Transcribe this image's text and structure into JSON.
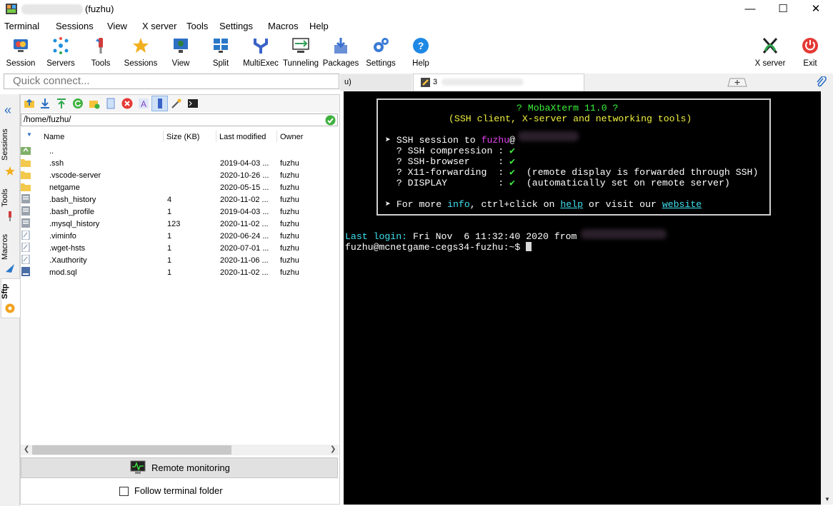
{
  "window": {
    "title": "(fuzhu)",
    "minimize": "—",
    "maximize": "☐",
    "close": "✕"
  },
  "menu": [
    "Terminal",
    "Sessions",
    "View",
    "X server",
    "Tools",
    "Settings",
    "Macros",
    "Help"
  ],
  "toolbar": [
    {
      "label": "Session",
      "icon": "session-icon",
      "color": "#3a7bd5"
    },
    {
      "label": "Servers",
      "icon": "servers-icon",
      "color": "#1f8fe0"
    },
    {
      "label": "Tools",
      "icon": "tools-icon",
      "color": "#d23b3b"
    },
    {
      "label": "Sessions",
      "icon": "star-icon",
      "color": "#f2b01e"
    },
    {
      "label": "View",
      "icon": "view-icon",
      "color": "#2f7f3f"
    },
    {
      "label": "Split",
      "icon": "split-icon",
      "color": "#2a78c8"
    },
    {
      "label": "MultiExec",
      "icon": "multiexec-icon",
      "color": "#3a62c8"
    },
    {
      "label": "Tunneling",
      "icon": "tunneling-icon",
      "color": "#2f9f5a"
    },
    {
      "label": "Packages",
      "icon": "packages-icon",
      "color": "#3a6fd0"
    },
    {
      "label": "Settings",
      "icon": "gear-icon",
      "color": "#3a7bd5"
    },
    {
      "label": "Help",
      "icon": "help-icon",
      "color": "#1e88e5"
    }
  ],
  "toolbar_right": [
    {
      "label": "X server",
      "icon": "x-server-icon"
    },
    {
      "label": "Exit",
      "icon": "power-icon"
    }
  ],
  "quick_connect": {
    "placeholder": "Quick connect..."
  },
  "side_tabs": [
    "Sessions",
    "Tools",
    "Macros",
    "Sftp"
  ],
  "sftp": {
    "path": "/home/fuzhu/",
    "columns": [
      "Name",
      "Size (KB)",
      "Last modified",
      "Owner"
    ],
    "rows": [
      {
        "name": "..",
        "size": "",
        "modified": "",
        "owner": "",
        "type": "up"
      },
      {
        "name": ".ssh",
        "size": "",
        "modified": "2019-04-03 ...",
        "owner": "fuzhu",
        "type": "folder"
      },
      {
        "name": ".vscode-server",
        "size": "",
        "modified": "2020-10-26 ...",
        "owner": "fuzhu",
        "type": "folder"
      },
      {
        "name": "netgame",
        "size": "",
        "modified": "2020-05-15 ...",
        "owner": "fuzhu",
        "type": "folder"
      },
      {
        "name": ".bash_history",
        "size": "4",
        "modified": "2020-11-02 ...",
        "owner": "fuzhu",
        "type": "file"
      },
      {
        "name": ".bash_profile",
        "size": "1",
        "modified": "2019-04-03 ...",
        "owner": "fuzhu",
        "type": "file"
      },
      {
        "name": ".mysql_history",
        "size": "123",
        "modified": "2020-11-02 ...",
        "owner": "fuzhu",
        "type": "file"
      },
      {
        "name": ".viminfo",
        "size": "1",
        "modified": "2020-06-24 ...",
        "owner": "fuzhu",
        "type": "doc"
      },
      {
        "name": ".wget-hsts",
        "size": "1",
        "modified": "2020-07-01 ...",
        "owner": "fuzhu",
        "type": "doc"
      },
      {
        "name": ".Xauthority",
        "size": "1",
        "modified": "2020-11-06 ...",
        "owner": "fuzhu",
        "type": "doc"
      },
      {
        "name": "mod.sql",
        "size": "1",
        "modified": "2020-11-02 ...",
        "owner": "fuzhu",
        "type": "sql"
      }
    ],
    "remote_monitoring": "Remote monitoring",
    "follow_folder": "Follow terminal folder"
  },
  "terminal": {
    "tabs": [
      "u)",
      "3"
    ],
    "banner_title": "? MobaXterm 11.0 ?",
    "banner_sub": "(SSH client, X-server and networking tools)",
    "ssh_session_prefix": "➤ SSH session to ",
    "ssh_user": "fuzhu",
    "ssh_at": "@",
    "lines": [
      {
        "label": "  ? SSH compression : ",
        "check": "✔",
        "note": ""
      },
      {
        "label": "  ? SSH-browser     : ",
        "check": "✔",
        "note": ""
      },
      {
        "label": "  ? X11-forwarding  : ",
        "check": "✔",
        "note": "  (remote display is forwarded through SSH)"
      },
      {
        "label": "  ? DISPLAY         : ",
        "check": "✔",
        "note": "  (automatically set on remote server)"
      }
    ],
    "more_prefix": "➤ For more ",
    "info": "info",
    "more_mid": ", ctrl+click on ",
    "help": "help",
    "more_or": " or visit our ",
    "website": "website",
    "last_login_label": "Last login:",
    "last_login_value": " Fri Nov  6 11:32:40 2020 from",
    "prompt": "fuzhu@mcnetgame-cegs34-fuzhu:~$ "
  }
}
